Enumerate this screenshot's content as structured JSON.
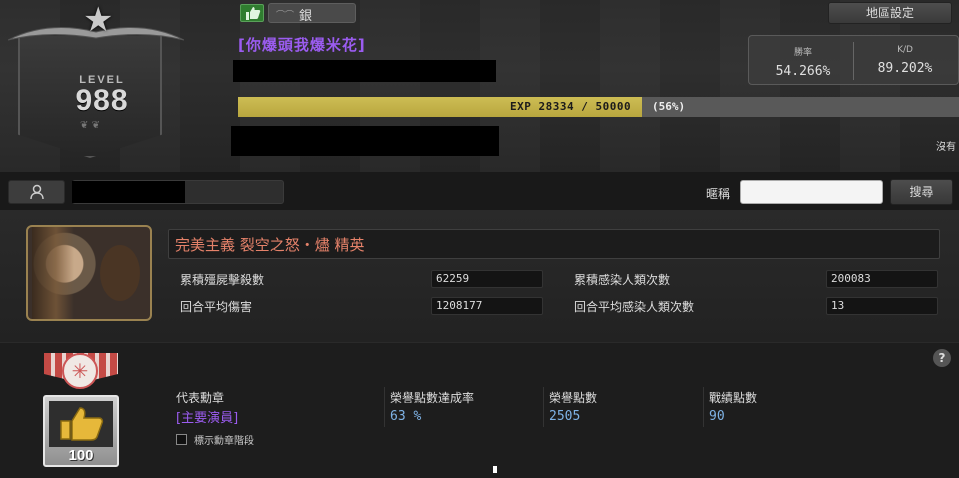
{
  "header": {
    "level_label": "LEVEL",
    "level": "988",
    "rank": "銀",
    "nickname": "[你爆頭我爆米花]",
    "exp_text": "EXP 28334 / 50000",
    "exp_percent_text": "(56%)",
    "exp_progress": 0.56,
    "region_button": "地區設定",
    "stats": {
      "winrate_label": "勝率",
      "winrate": "54.266%",
      "kd_label": "K/D",
      "kd": "89.202%"
    },
    "truncated_text": "沒有"
  },
  "search": {
    "nick_label": "暱稱",
    "nick_value": "",
    "search_button": "搜尋"
  },
  "mode": {
    "title": "完美主義 裂空之怒・燼 精英",
    "rows": [
      {
        "label": "累積殭屍擊殺數",
        "value": "62259",
        "label2": "累積感染人類次數",
        "value2": "200083"
      },
      {
        "label": "回合平均傷害",
        "value": "1208177",
        "label2": "回合平均感染人類次數",
        "value2": "13"
      }
    ]
  },
  "medal": {
    "plaque_number": "100",
    "rep_label": "代表勳章",
    "rep_value": "[主要演員]",
    "checkbox_label": "標示勳章階段",
    "honor_rate_label": "榮譽點數達成率",
    "honor_rate": "63 %",
    "honor_label": "榮譽點數",
    "honor": "2505",
    "battle_label": "戰績點數",
    "battle": "90",
    "help": "?"
  },
  "colors": {
    "nickname": "#9b5cf0",
    "exp_fill": "#c4b24a",
    "mode_title": "#e5826a",
    "medal_values": "#7fb3e6"
  }
}
